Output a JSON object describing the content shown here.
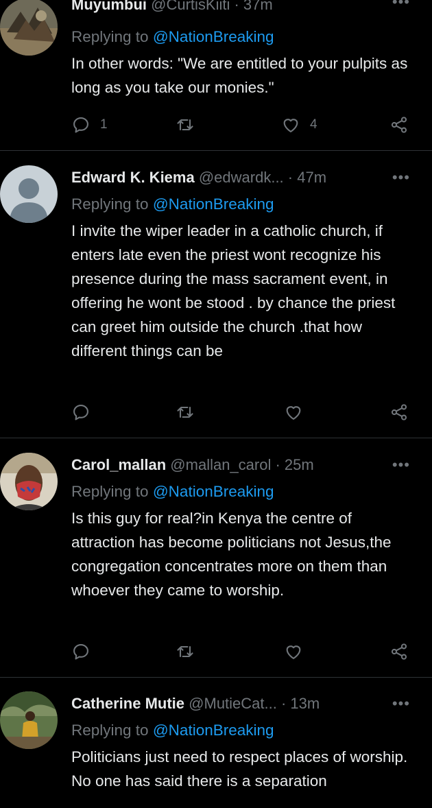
{
  "tweets": [
    {
      "name": "Muyumbui",
      "handle": "@CurtisKiiti",
      "time": "37m",
      "handle_time": "@CurtisKiiti · 37m",
      "replying_prefix": "Replying to",
      "replying_to": "@NationBreaking",
      "text": "In other words: \"We are entitled to your pulpits as long as you take our monies.\"",
      "reply_count": "1",
      "retweet_count": "",
      "like_count": "4"
    },
    {
      "name": "Edward K. Kiema",
      "handle": "@edwardk...",
      "time": "47m",
      "handle_time": "@edwardk... · 47m",
      "replying_prefix": "Replying to",
      "replying_to": "@NationBreaking",
      "text": "I invite the wiper leader in a catholic church, if enters late even the priest wont recognize his presence during the mass sacrament event, in offering he wont be stood . by chance the priest can greet him outside the church .that how different things can be",
      "reply_count": "",
      "retweet_count": "",
      "like_count": ""
    },
    {
      "name": "Carol_mallan",
      "handle": "@mallan_carol",
      "time": "25m",
      "handle_time": "@mallan_carol · 25m",
      "replying_prefix": "Replying to",
      "replying_to": "@NationBreaking",
      "text": "Is this guy for real?in Kenya the centre of attraction has become politicians not Jesus,the congregation concentrates more on them than whoever they came to worship.",
      "reply_count": "",
      "retweet_count": "",
      "like_count": ""
    },
    {
      "name": "Catherine Mutie",
      "handle": "@MutieCat...",
      "time": "13m",
      "handle_time": "@MutieCat... · 13m",
      "replying_prefix": "Replying to",
      "replying_to": "@NationBreaking",
      "text": "Politicians just need to respect places of worship. No one has said there is a separation",
      "reply_count": "",
      "retweet_count": "",
      "like_count": ""
    }
  ],
  "more_label": "•••",
  "colors": {
    "background": "#000000",
    "accent": "#1d9bf0",
    "muted": "#71767b",
    "text": "#e7e9ea",
    "divider": "#2f3336"
  },
  "icons": [
    "reply-icon",
    "retweet-icon",
    "like-icon",
    "share-icon",
    "more-icon"
  ]
}
